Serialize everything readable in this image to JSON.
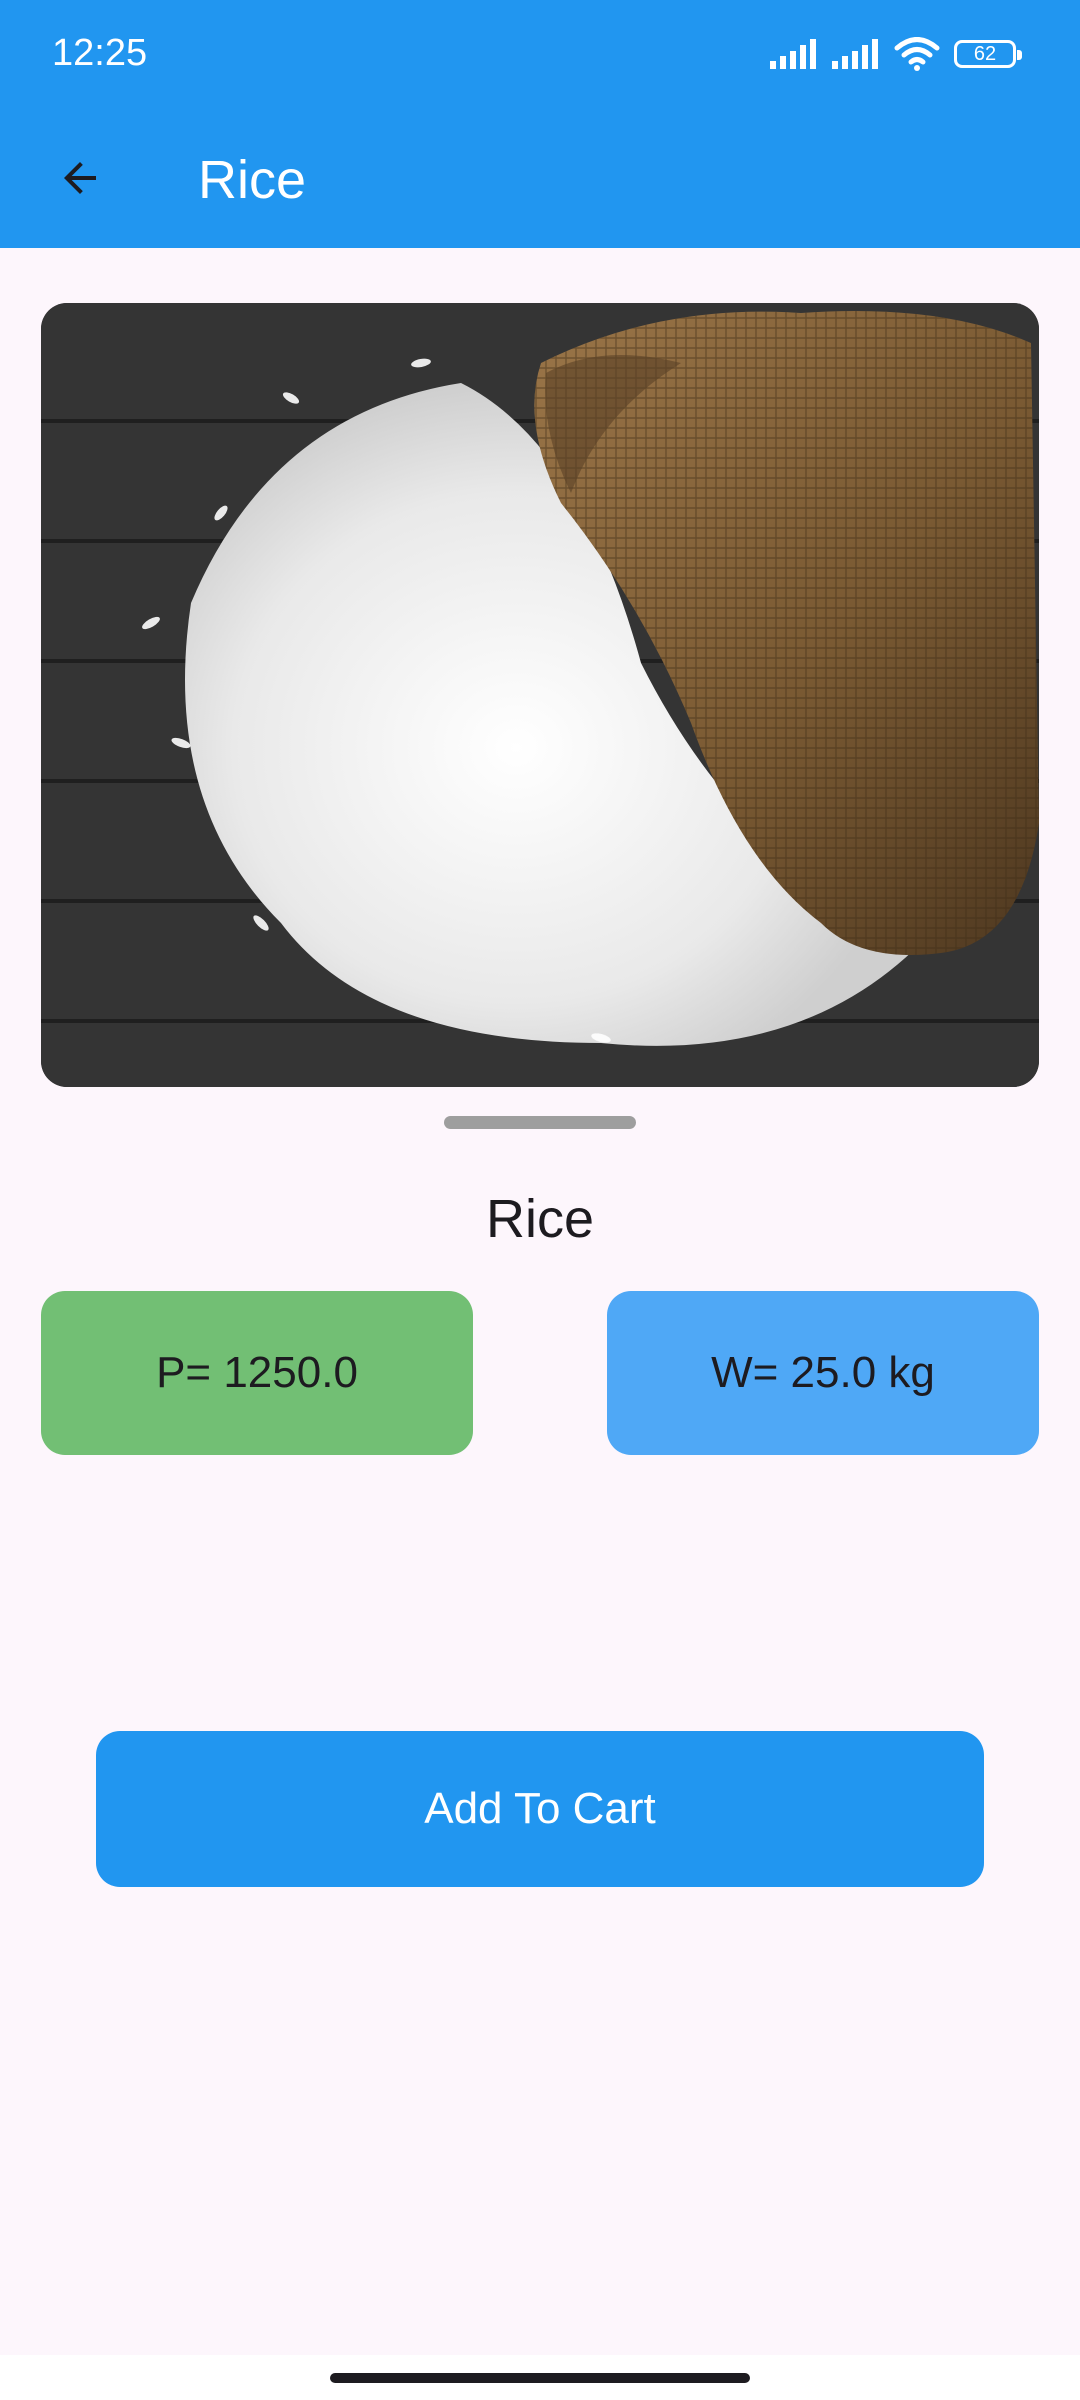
{
  "status_bar": {
    "time": "12:25",
    "battery": "62"
  },
  "app_bar": {
    "title": "Rice",
    "back_icon": "arrow-back-icon"
  },
  "product": {
    "image_icon": "rice-sack-photo",
    "name": "Rice",
    "price_label": "P= 1250.0",
    "weight_label": "W= 25.0 kg"
  },
  "actions": {
    "add_to_cart": "Add To Cart"
  },
  "colors": {
    "primary": "#2196f0",
    "price_chip": "#72bf74",
    "weight_chip": "#4fa8f6",
    "background": "#fdf6fc"
  }
}
